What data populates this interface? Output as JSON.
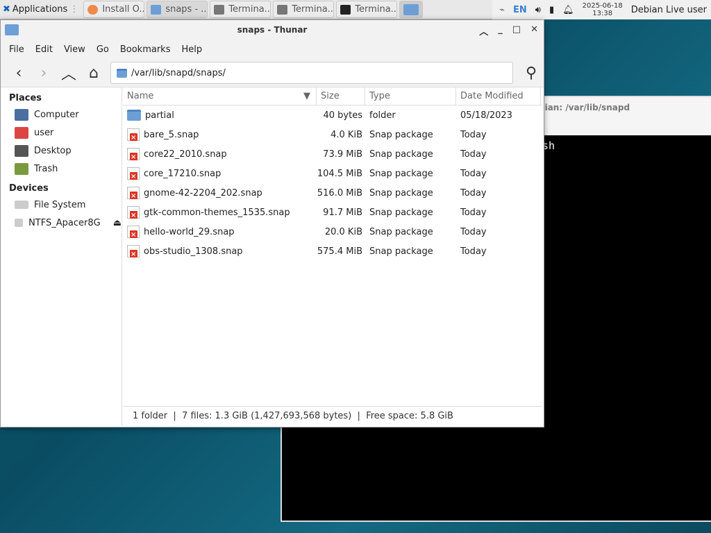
{
  "panel": {
    "apps_label": "Applications",
    "tasks": [
      "Install O...",
      "snaps - ...",
      "Termina...",
      "Termina...",
      "Termina..."
    ],
    "lang": "EN",
    "date": "2025-06-18",
    "time": "13:38",
    "user": "Debian Live user"
  },
  "terminal": {
    "title": "bian: /var/lib/snapd",
    "text": "sh"
  },
  "window": {
    "title": "snaps - Thunar",
    "menu": [
      "File",
      "Edit",
      "View",
      "Go",
      "Bookmarks",
      "Help"
    ],
    "location": "/var/lib/snapd/snaps/",
    "sidebar": {
      "places_label": "Places",
      "places": [
        "Computer",
        "user",
        "Desktop",
        "Trash"
      ],
      "devices_label": "Devices",
      "devices": [
        "File System",
        "NTFS_Apacer8G"
      ]
    },
    "columns": [
      "Name",
      "Size",
      "Type",
      "Date Modified"
    ],
    "files": [
      {
        "name": "partial",
        "size": "40 bytes",
        "type": "folder",
        "date": "05/18/2023"
      },
      {
        "name": "bare_5.snap",
        "size": "4.0 KiB",
        "type": "Snap package",
        "date": "Today"
      },
      {
        "name": "core22_2010.snap",
        "size": "73.9 MiB",
        "type": "Snap package",
        "date": "Today"
      },
      {
        "name": "core_17210.snap",
        "size": "104.5 MiB",
        "type": "Snap package",
        "date": "Today"
      },
      {
        "name": "gnome-42-2204_202.snap",
        "size": "516.0 MiB",
        "type": "Snap package",
        "date": "Today"
      },
      {
        "name": "gtk-common-themes_1535.snap",
        "size": "91.7 MiB",
        "type": "Snap package",
        "date": "Today"
      },
      {
        "name": "hello-world_29.snap",
        "size": "20.0 KiB",
        "type": "Snap package",
        "date": "Today"
      },
      {
        "name": "obs-studio_1308.snap",
        "size": "575.4 MiB",
        "type": "Snap package",
        "date": "Today"
      }
    ],
    "status": "1 folder  |  7 files: 1.3 GiB (1,427,693,568 bytes)  |  Free space: 5.8 GiB"
  }
}
